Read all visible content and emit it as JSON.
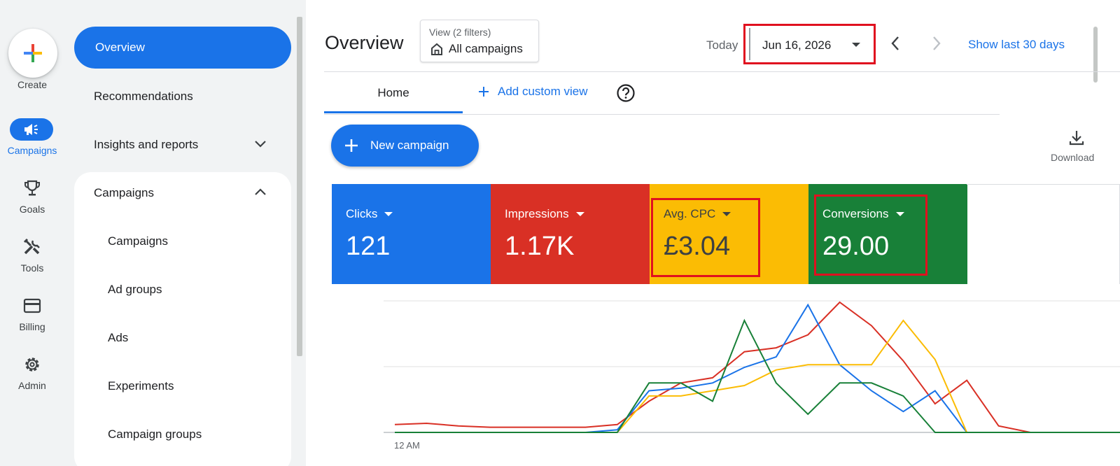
{
  "rail": {
    "create_label": "Create",
    "items": [
      {
        "label": "Campaigns",
        "icon": "megaphone-icon",
        "active": true
      },
      {
        "label": "Goals",
        "icon": "trophy-icon",
        "active": false
      },
      {
        "label": "Tools",
        "icon": "tools-icon",
        "active": false
      },
      {
        "label": "Billing",
        "icon": "credit-card-icon",
        "active": false
      },
      {
        "label": "Admin",
        "icon": "gear-icon",
        "active": false
      }
    ]
  },
  "nav": {
    "overview": "Overview",
    "recommendations": "Recommendations",
    "insights": "Insights and reports",
    "campaigns_header": "Campaigns",
    "sub_items": [
      "Campaigns",
      "Ad groups",
      "Ads",
      "Experiments",
      "Campaign groups"
    ]
  },
  "header": {
    "title": "Overview",
    "view_filters": "View (2 filters)",
    "view_name": "All campaigns",
    "today_label": "Today",
    "date": "Jun 16, 2026",
    "show_last": "Show last 30 days"
  },
  "tabs": {
    "home": "Home",
    "add_custom_view": "Add custom view"
  },
  "actions": {
    "new_campaign": "New campaign",
    "download": "Download"
  },
  "metrics": [
    {
      "label": "Clicks",
      "value": "121",
      "color": "#1a73e8"
    },
    {
      "label": "Impressions",
      "value": "1.17K",
      "color": "#d93025"
    },
    {
      "label": "Avg. CPC",
      "value": "£3.04",
      "color": "#fbbc04"
    },
    {
      "label": "Conversions",
      "value": "29.00",
      "color": "#188038"
    }
  ],
  "colors": {
    "accent": "#1a73e8",
    "highlight": "#e0101f"
  },
  "chart_data": {
    "type": "line",
    "x_tick_labels": [
      "12 AM"
    ],
    "grid": true,
    "series": [
      {
        "name": "Impressions",
        "color": "#d93025",
        "values": [
          0.06,
          0.07,
          0.05,
          0.04,
          0.04,
          0.04,
          0.04,
          0.06,
          0.24,
          0.38,
          0.42,
          0.62,
          0.65,
          0.75,
          1.0,
          0.82,
          0.55,
          0.22,
          0.4,
          0.05,
          0.0,
          0.0,
          0.0,
          0.0
        ]
      },
      {
        "name": "Clicks",
        "color": "#1a73e8",
        "values": [
          0.0,
          0.0,
          0.0,
          0.0,
          0.0,
          0.0,
          0.0,
          0.02,
          0.32,
          0.34,
          0.38,
          0.5,
          0.58,
          0.98,
          0.52,
          0.32,
          0.16,
          0.32,
          0.0,
          0.0,
          0.0,
          0.0,
          0.0,
          0.0
        ]
      },
      {
        "name": "Avg. CPC",
        "color": "#fbbc04",
        "values": [
          0.0,
          0.0,
          0.0,
          0.0,
          0.0,
          0.0,
          0.0,
          0.0,
          0.28,
          0.28,
          0.32,
          0.36,
          0.48,
          0.52,
          0.52,
          0.52,
          0.86,
          0.56,
          0.0,
          0.0,
          0.0,
          0.0,
          0.0,
          0.0
        ]
      },
      {
        "name": "Conversions",
        "color": "#188038",
        "values": [
          0.0,
          0.0,
          0.0,
          0.0,
          0.0,
          0.0,
          0.0,
          0.0,
          0.38,
          0.38,
          0.24,
          0.86,
          0.38,
          0.14,
          0.38,
          0.38,
          0.28,
          0.0,
          0.0,
          0.0,
          0.0,
          0.0,
          0.0,
          0.0
        ]
      }
    ]
  }
}
